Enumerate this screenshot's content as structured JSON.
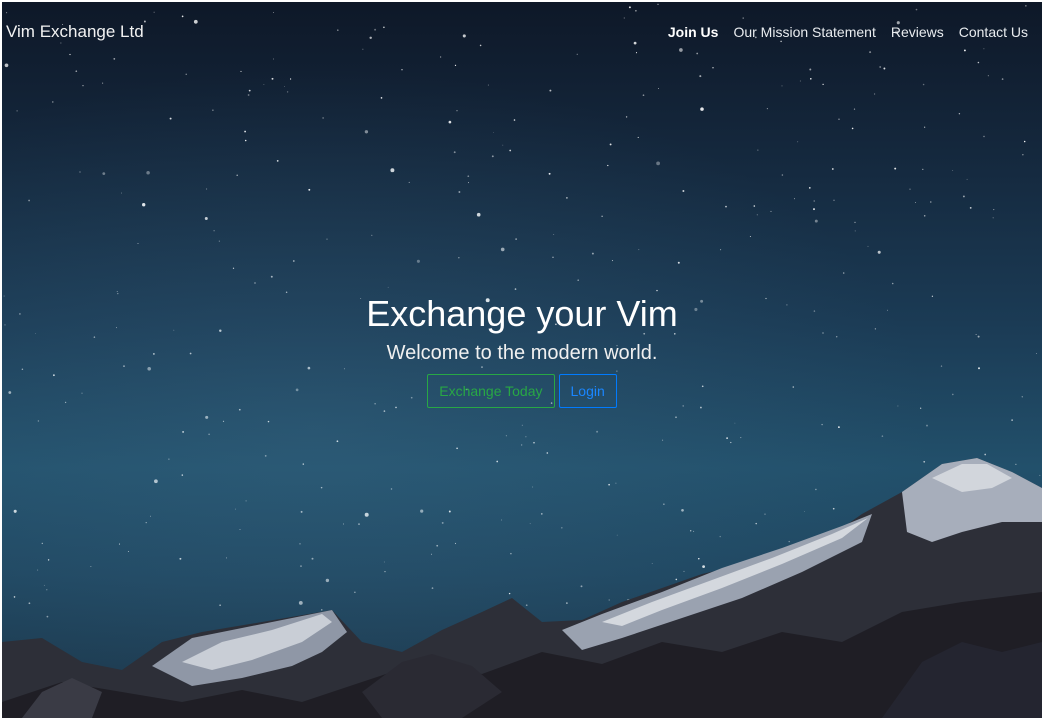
{
  "navbar": {
    "brand": "Vim Exchange Ltd",
    "links": [
      {
        "label": "Join Us",
        "active": true
      },
      {
        "label": "Our Mission Statement",
        "active": false
      },
      {
        "label": "Reviews",
        "active": false
      },
      {
        "label": "Contact Us",
        "active": false
      }
    ]
  },
  "hero": {
    "title": "Exchange your Vim",
    "subtitle": "Welcome to the modern world.",
    "buttons": {
      "exchange_label": "Exchange Today",
      "login_label": "Login"
    }
  },
  "colors": {
    "success": "#28a745",
    "primary": "#007bff",
    "sky_top": "#0e1828",
    "sky_mid": "#22506b"
  }
}
